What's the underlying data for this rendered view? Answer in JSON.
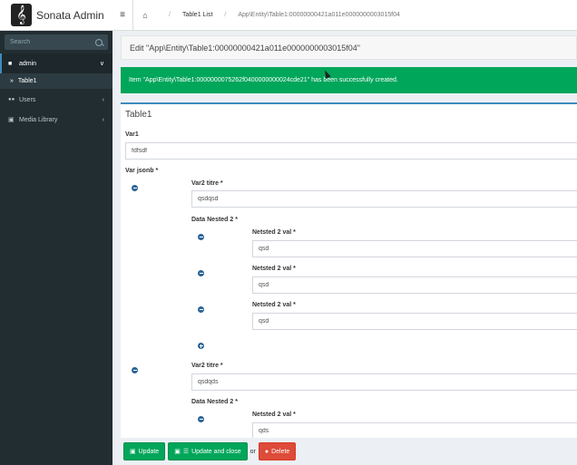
{
  "app": {
    "brand": "Sonata Admin",
    "logo_glyph": "𝄞"
  },
  "sidebar": {
    "search_placeholder": "Search",
    "items": [
      {
        "label": "admin",
        "icon": "folder-icon",
        "glyph": "■",
        "chevron": "∨"
      },
      {
        "label": "Table1",
        "icon": "double-chevron-icon",
        "glyph": "»"
      },
      {
        "label": "Users",
        "icon": "users-icon",
        "glyph": "👥",
        "chevron": "‹"
      },
      {
        "label": "Media Library",
        "icon": "image-icon",
        "glyph": "▣",
        "chevron": "‹"
      }
    ]
  },
  "header": {
    "burger": "≡",
    "home": "⌂",
    "sep": "/",
    "crumbs": [
      "Table1 List",
      "App\\Entity\\Table1:00000000421a011e0000000003015f04"
    ]
  },
  "main": {
    "title": "Edit \"App\\Entity\\Table1:00000000421a011e0000000003015f04\"",
    "alert": "Item \"App\\Entity\\Table1:0000000075262f0400000000024cde21\" has been successfully created.",
    "box_title": "Table1",
    "var1_label": "Var1",
    "var1_value": "fdfsdf",
    "var_jsonb_label": "Var jsonb *",
    "entries": [
      {
        "titre_label": "Var2 titre *",
        "titre_value": "qsdqsd",
        "nested_label": "Data Nested 2 *",
        "nested": [
          {
            "label": "Netsted 2 val *",
            "value": "qsd"
          },
          {
            "label": "Netsted 2 val *",
            "value": "qsd"
          },
          {
            "label": "Netsted 2 val *",
            "value": "qsd"
          }
        ]
      },
      {
        "titre_label": "Var2 titre *",
        "titre_value": "qsdqds",
        "nested_label": "Data Nested 2 *",
        "nested": [
          {
            "label": "Netsted 2 val *",
            "value": "qds"
          }
        ]
      }
    ]
  },
  "footer": {
    "update": "Update",
    "update_close": "Update and close",
    "or": "or",
    "delete": "Delete",
    "update_icon": "save-icon",
    "delete_icon": "minus-circle-icon"
  },
  "colors": {
    "success": "#00a65a",
    "danger": "#dd4b39",
    "sidebar": "#222d32",
    "accent": "#3c8dbc"
  }
}
